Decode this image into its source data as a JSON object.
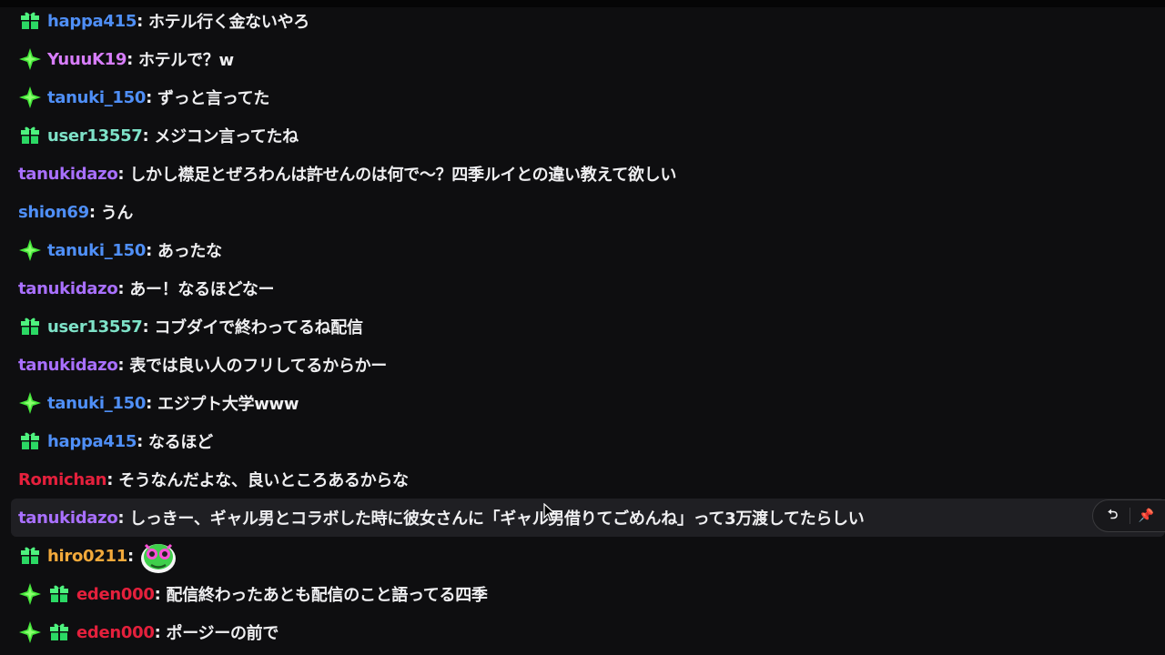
{
  "colors": {
    "background": "#0e0e10",
    "hover_background": "#1f1f23",
    "text": "#efeff1"
  },
  "messages": [
    {
      "badges": [
        "gift-icon"
      ],
      "username": "happa415",
      "color": "#4f8ff7",
      "text": "ホテル行く金ないやろ"
    },
    {
      "badges": [
        "sparkle-icon"
      ],
      "username": "YuuuK19",
      "color": "#d77dfb",
      "text": "ホテルで？w"
    },
    {
      "badges": [
        "sparkle-icon"
      ],
      "username": "tanuki_150",
      "color": "#4f8ff7",
      "text": "ずっと言ってた"
    },
    {
      "badges": [
        "gift-icon"
      ],
      "username": "user13557",
      "color": "#7ee2c8",
      "text": "メジコン言ってたね"
    },
    {
      "badges": [],
      "username": "tanukidazo",
      "color": "#a970ff",
      "text": "しかし襟足とぜろわんは許せんのは何で～？四季ルイとの違い教えて欲しい"
    },
    {
      "badges": [],
      "username": "shion69",
      "color": "#4f8ff7",
      "text": "うん"
    },
    {
      "badges": [
        "sparkle-icon"
      ],
      "username": "tanuki_150",
      "color": "#4f8ff7",
      "text": "あったな"
    },
    {
      "badges": [],
      "username": "tanukidazo",
      "color": "#a970ff",
      "text": "あー！なるほどなー"
    },
    {
      "badges": [
        "gift-icon"
      ],
      "username": "user13557",
      "color": "#7ee2c8",
      "text": "コブダイで終わってるね配信"
    },
    {
      "badges": [],
      "username": "tanukidazo",
      "color": "#a970ff",
      "text": "表では良い人のフリしてるからかー"
    },
    {
      "badges": [
        "sparkle-icon"
      ],
      "username": "tanuki_150",
      "color": "#4f8ff7",
      "text": "エジプト大学www"
    },
    {
      "badges": [
        "gift-icon"
      ],
      "username": "happa415",
      "color": "#4f8ff7",
      "text": "なるほど"
    },
    {
      "badges": [],
      "username": "Romichan",
      "color": "#e4203c",
      "text": "そうなんだよな、良いところあるからな"
    },
    {
      "badges": [],
      "username": "tanukidazo",
      "color": "#a970ff",
      "text": "しっきー、ギャル男とコラボした時に彼女さんに「ギャル男借りてごめんね」って3万渡してたらしい",
      "hover": true
    },
    {
      "badges": [
        "gift-icon"
      ],
      "username": "hiro0211",
      "color": "#f2a93b",
      "text": "",
      "emote": "green-blob-emote"
    },
    {
      "badges": [
        "sparkle-icon",
        "gift-icon"
      ],
      "username": "eden000",
      "color": "#e4203c",
      "text": "配信終わったあとも配信のこと語ってる四季"
    },
    {
      "badges": [
        "sparkle-icon",
        "gift-icon"
      ],
      "username": "eden000",
      "color": "#e4203c",
      "text": "ポージーの前で"
    }
  ],
  "hover_actions": [
    {
      "icon": "reply-icon",
      "glyph": "⮌"
    },
    {
      "icon": "pin-icon",
      "glyph": "📌"
    }
  ]
}
